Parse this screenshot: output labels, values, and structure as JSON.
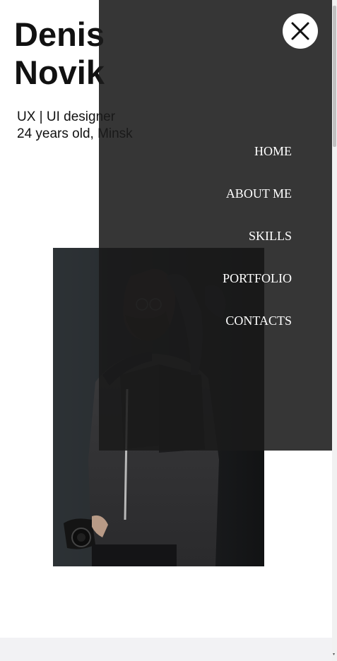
{
  "hero": {
    "first_name": "Denis",
    "last_name": "Novik",
    "role": "UX | UI designer",
    "info": "24 years old, Minsk"
  },
  "menu": {
    "close_icon": "close-icon",
    "items": [
      {
        "label": "HOME"
      },
      {
        "label": "ABOUT ME"
      },
      {
        "label": "SKILLS"
      },
      {
        "label": "PORTFOLIO"
      },
      {
        "label": "CONTACTS"
      }
    ]
  },
  "colors": {
    "overlay": "#1a1a1a",
    "nav_text": "#ffffff",
    "text": "#111111"
  }
}
